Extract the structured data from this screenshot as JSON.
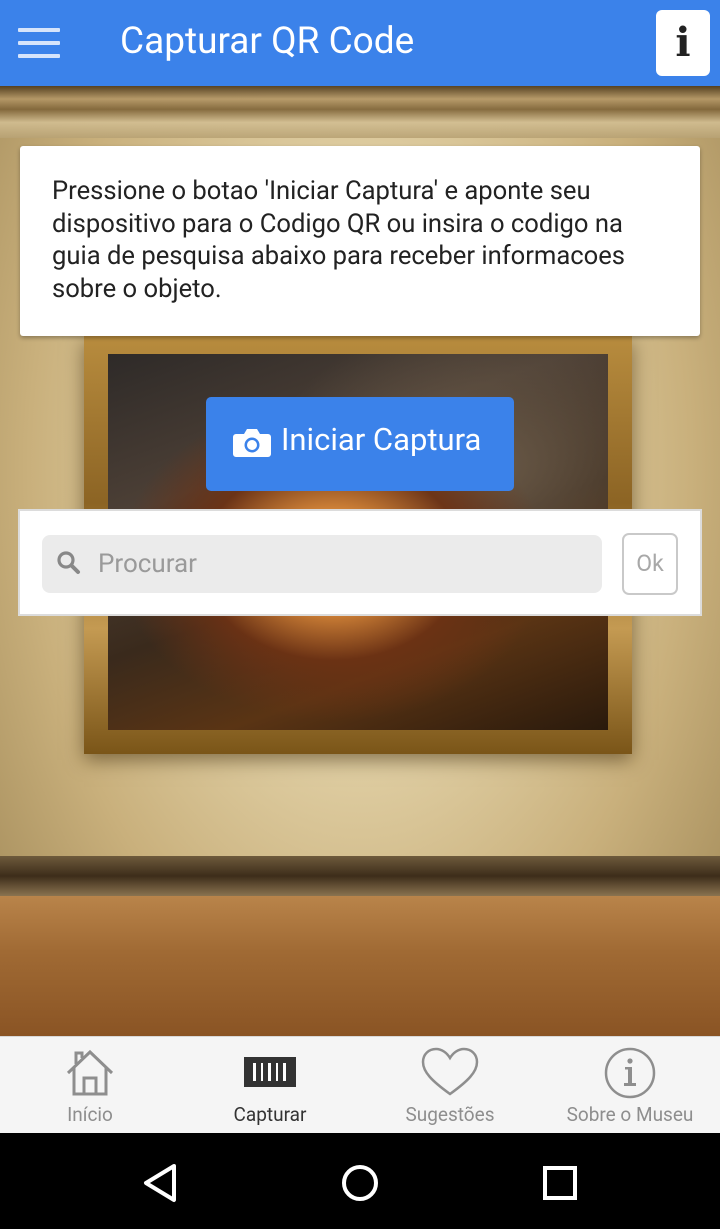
{
  "app_bar": {
    "title": "Capturar QR Code",
    "menu_icon": "hamburger-menu-icon",
    "info_button_label": "i",
    "color": "#3b82ea"
  },
  "instruction": {
    "text": "Pressione o botao 'Iniciar Captura' e aponte seu dispositivo para o Codigo QR ou insira o codigo na guia de pesquisa abaixo para receber informacoes sobre o objeto."
  },
  "capture_button": {
    "label": "Iniciar Captura",
    "icon": "camera-icon"
  },
  "search": {
    "placeholder": "Procurar",
    "value": "",
    "icon": "search-icon",
    "ok_label": "Ok"
  },
  "bottom_nav": {
    "items": [
      {
        "label": "Início",
        "icon": "home-icon",
        "active": false
      },
      {
        "label": "Capturar",
        "icon": "barcode-icon",
        "active": true
      },
      {
        "label": "Sugestões",
        "icon": "heart-icon",
        "active": false
      },
      {
        "label": "Sobre o Museu",
        "icon": "info-circle-icon",
        "active": false
      }
    ]
  },
  "system_nav": {
    "buttons": [
      "back-icon",
      "home-circle-icon",
      "recents-square-icon"
    ]
  }
}
